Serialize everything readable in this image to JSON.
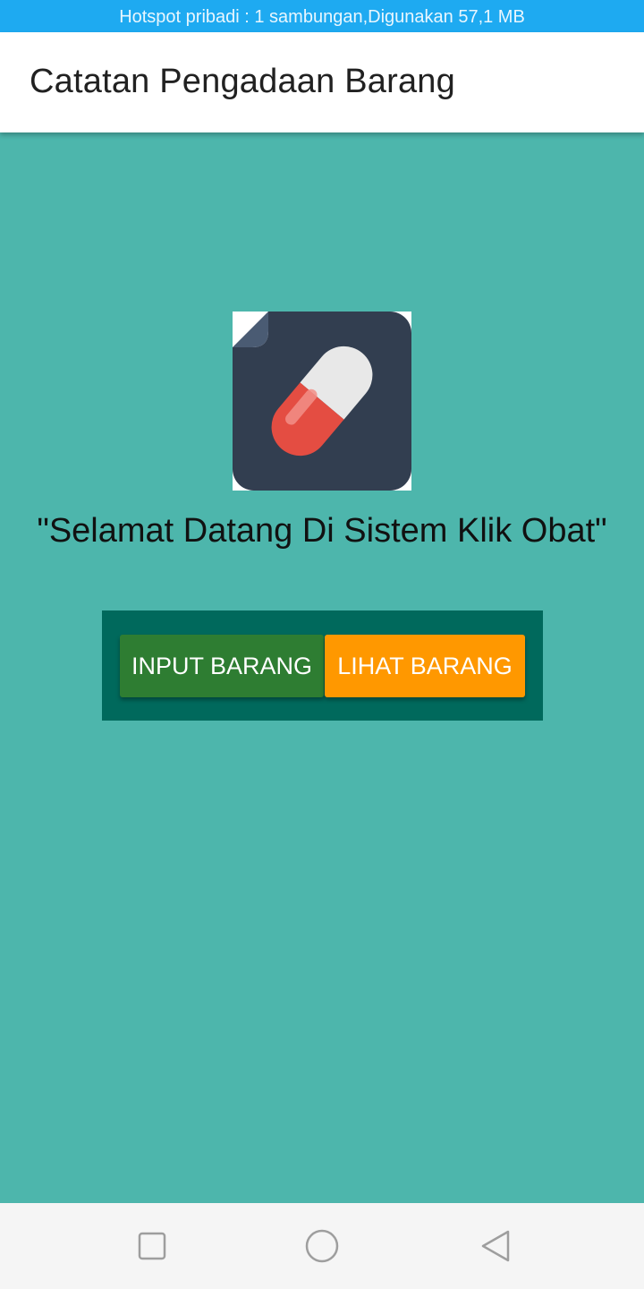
{
  "status_bar": {
    "text": "Hotspot pribadi : 1 sambungan,Digunakan 57,1 MB"
  },
  "app_bar": {
    "title": "Catatan Pengadaan Barang"
  },
  "main": {
    "logo_icon": "pill-capsule-icon",
    "welcome_text": "\"Selamat Datang Di Sistem Klik Obat\"",
    "buttons": {
      "input_label": "INPUT BARANG",
      "view_label": "LIHAT BARANG"
    }
  },
  "colors": {
    "status_bar": "#1eaaf1",
    "background": "#4db6ac",
    "panel": "#00695c",
    "input_button": "#2e7d32",
    "view_button": "#ff9800"
  },
  "nav_bar": {
    "icons": [
      "recent-apps-icon",
      "home-icon",
      "back-icon"
    ]
  }
}
